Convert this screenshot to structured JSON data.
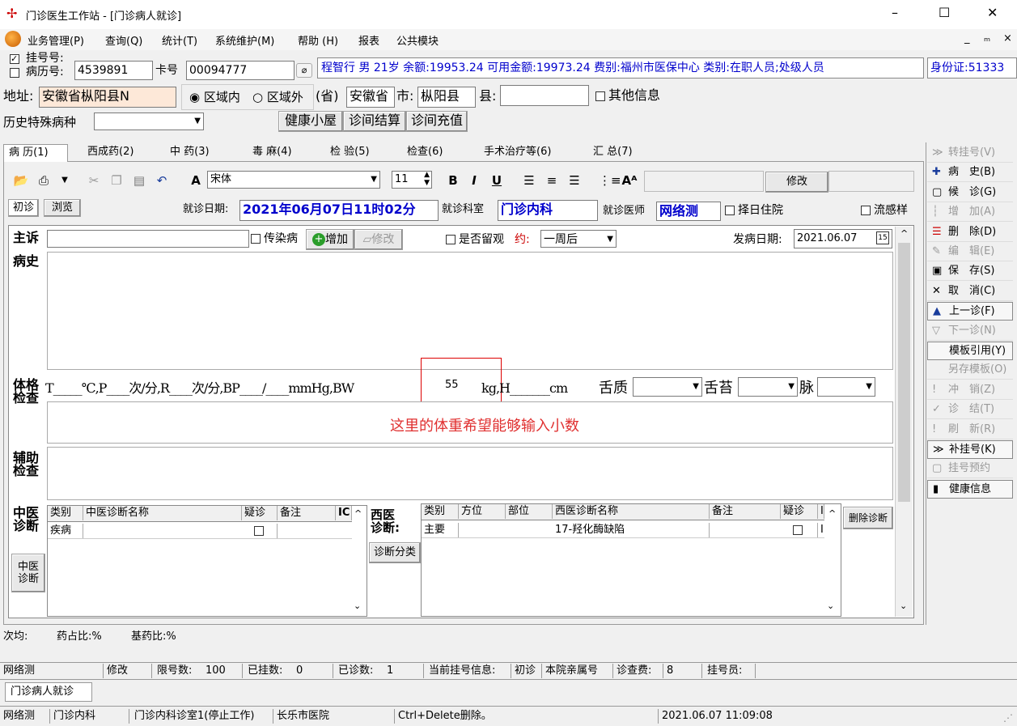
{
  "window": {
    "title": "门诊医生工作站 - [门诊病人就诊]",
    "minimize": "–",
    "maximize": "☐",
    "close": "✕"
  },
  "menu": {
    "items": [
      "业务管理(P)",
      "查询(Q)",
      "统计(T)",
      "系统维护(M)",
      "帮助 (H)",
      "报表",
      "公共模块"
    ],
    "mdi": [
      "_",
      "ₘ",
      "×"
    ]
  },
  "patient": {
    "reg_label": "挂号号:",
    "record_label": "病历号:",
    "reg_no": "4539891",
    "card_label": "卡号",
    "card_no": "00094777",
    "info": "程智行 男 21岁 余额:19953.24 可用金额:19973.24 费别:福州市医保中心 类别:在职人员;处级人员",
    "id_label": "身份证:51333",
    "address_label": "地址:",
    "address": "安徽省枞阳县N",
    "in_area": "区域内",
    "out_area": "区域外",
    "prov_paren": "(省)",
    "province": "安徽省",
    "city_label": "市:",
    "city": "枞阳县",
    "county_label": "县:",
    "county": "",
    "other_info": "其他信息",
    "history_label": "历史特殊病种",
    "history_value": "",
    "btn_health": "健康小屋",
    "btn_settle": "诊间结算",
    "btn_recharge": "诊间充值"
  },
  "tabs": [
    "病 历(1)",
    "西成药(2)",
    "中 药(3)",
    "毒 麻(4)",
    "检 验(5)",
    "检查(6)",
    "手术治疗等(6)",
    "汇 总(7)"
  ],
  "toolbar": {
    "font": "宋体",
    "size": "11",
    "bold": "B",
    "italic": "I",
    "underline": "U",
    "modify": "修改"
  },
  "visit": {
    "first": "初诊",
    "browse": "浏览",
    "date_label": "就诊日期:",
    "date": "2021年06月07日11时02分",
    "dept_label": "就诊科室",
    "dept": "门诊内科",
    "doctor_label": "就诊医师",
    "doctor": "网络测",
    "inpatient": "择日住院",
    "flu": "流感样"
  },
  "complaint": {
    "label": "主诉",
    "infectious": "传染病",
    "add": "增加",
    "edit": "修改",
    "observe": "是否留观",
    "appt_label": "约:",
    "appt": "一周后",
    "onset_label": "发病日期:",
    "onset": "2021.06.07"
  },
  "history": {
    "label": "病史"
  },
  "exam": {
    "label1": "体格",
    "label2": "检查",
    "template": "T_____℃,P____次/分,R____次/分,BP____/____mmHg,BW",
    "bw_value": "55",
    "after_bw": "kg,H_______cm",
    "tongue": "舌质",
    "coating": "舌苔",
    "pulse": "脉",
    "annotation": "这里的体重希望能够输入小数"
  },
  "aux": {
    "label1": "辅助",
    "label2": "检查"
  },
  "tcm": {
    "label1": "中医",
    "label2": "诊断",
    "headers": [
      "类别",
      "中医诊断名称",
      "疑诊",
      "备注",
      "IC"
    ],
    "rows": [
      [
        "疾病",
        "",
        "",
        "",
        ""
      ]
    ],
    "side_btn1": "中医",
    "side_btn2": "诊断"
  },
  "western": {
    "label1": "西医",
    "label2": "诊断:",
    "classify": "诊断分类",
    "headers": [
      "类别",
      "方位",
      "部位",
      "西医诊断名称",
      "备注",
      "疑诊",
      "I"
    ],
    "rows": [
      [
        "主要",
        "",
        "",
        "17-羟化酶缺陷",
        "",
        "",
        "I"
      ]
    ],
    "delete": "删除诊断"
  },
  "side": [
    {
      "label": "转挂号(V)",
      "icon": "≫",
      "dis": true
    },
    {
      "label": "病　史(B)",
      "icon": "✚",
      "dis": false
    },
    {
      "label": "候　诊(G)",
      "icon": "▢",
      "dis": false
    },
    {
      "label": "增　加(A)",
      "icon": "┆",
      "dis": true
    },
    {
      "label": "删　除(D)",
      "icon": "☰",
      "dis": false
    },
    {
      "label": "编　辑(E)",
      "icon": "✎",
      "dis": true
    },
    {
      "label": "保　存(S)",
      "icon": "▣",
      "dis": false
    },
    {
      "label": "取　消(C)",
      "icon": "✕",
      "dis": false
    },
    {
      "label": "上一诊(F)",
      "icon": "▲",
      "dis": false
    },
    {
      "label": "下一诊(N)",
      "icon": "▽",
      "dis": true
    },
    {
      "label": "模板引用(Y)",
      "icon": "",
      "dis": false
    },
    {
      "label": "另存模板(O)",
      "icon": "",
      "dis": true
    },
    {
      "label": "冲　销(Z)",
      "icon": "!",
      "dis": true
    },
    {
      "label": "诊　结(T)",
      "icon": "✓",
      "dis": true
    },
    {
      "label": "刷　新(R)",
      "icon": "!",
      "dis": true
    },
    {
      "label": "补挂号(K)",
      "icon": "≫",
      "dis": false
    },
    {
      "label": "挂号预约",
      "icon": "▢",
      "dis": true
    },
    {
      "label": "健康信息",
      "icon": "▮",
      "dis": false
    }
  ],
  "ratio": {
    "avg": "次均:",
    "drug": "药占比:%",
    "base": "基药比:%"
  },
  "status1": {
    "user": "网络测",
    "modify": "修改",
    "limit_label": "限号数:",
    "limit": "100",
    "registered_label": "已挂数:",
    "registered": "0",
    "seen_label": "已诊数:",
    "seen": "1",
    "current_label": "当前挂号信息:",
    "first": "初诊",
    "relative": "本院亲属号",
    "fee_label": "诊查费:",
    "fee": "8",
    "registrar_label": "挂号员:"
  },
  "doc_tab": "门诊病人就诊",
  "status2": {
    "user": "网络测",
    "dept": "门诊内科",
    "room": "门诊内科诊室1(停止工作)",
    "hospital": "长乐市医院",
    "hint": "Ctrl+Delete删除。",
    "time": "2021.06.07 11:09:08"
  }
}
